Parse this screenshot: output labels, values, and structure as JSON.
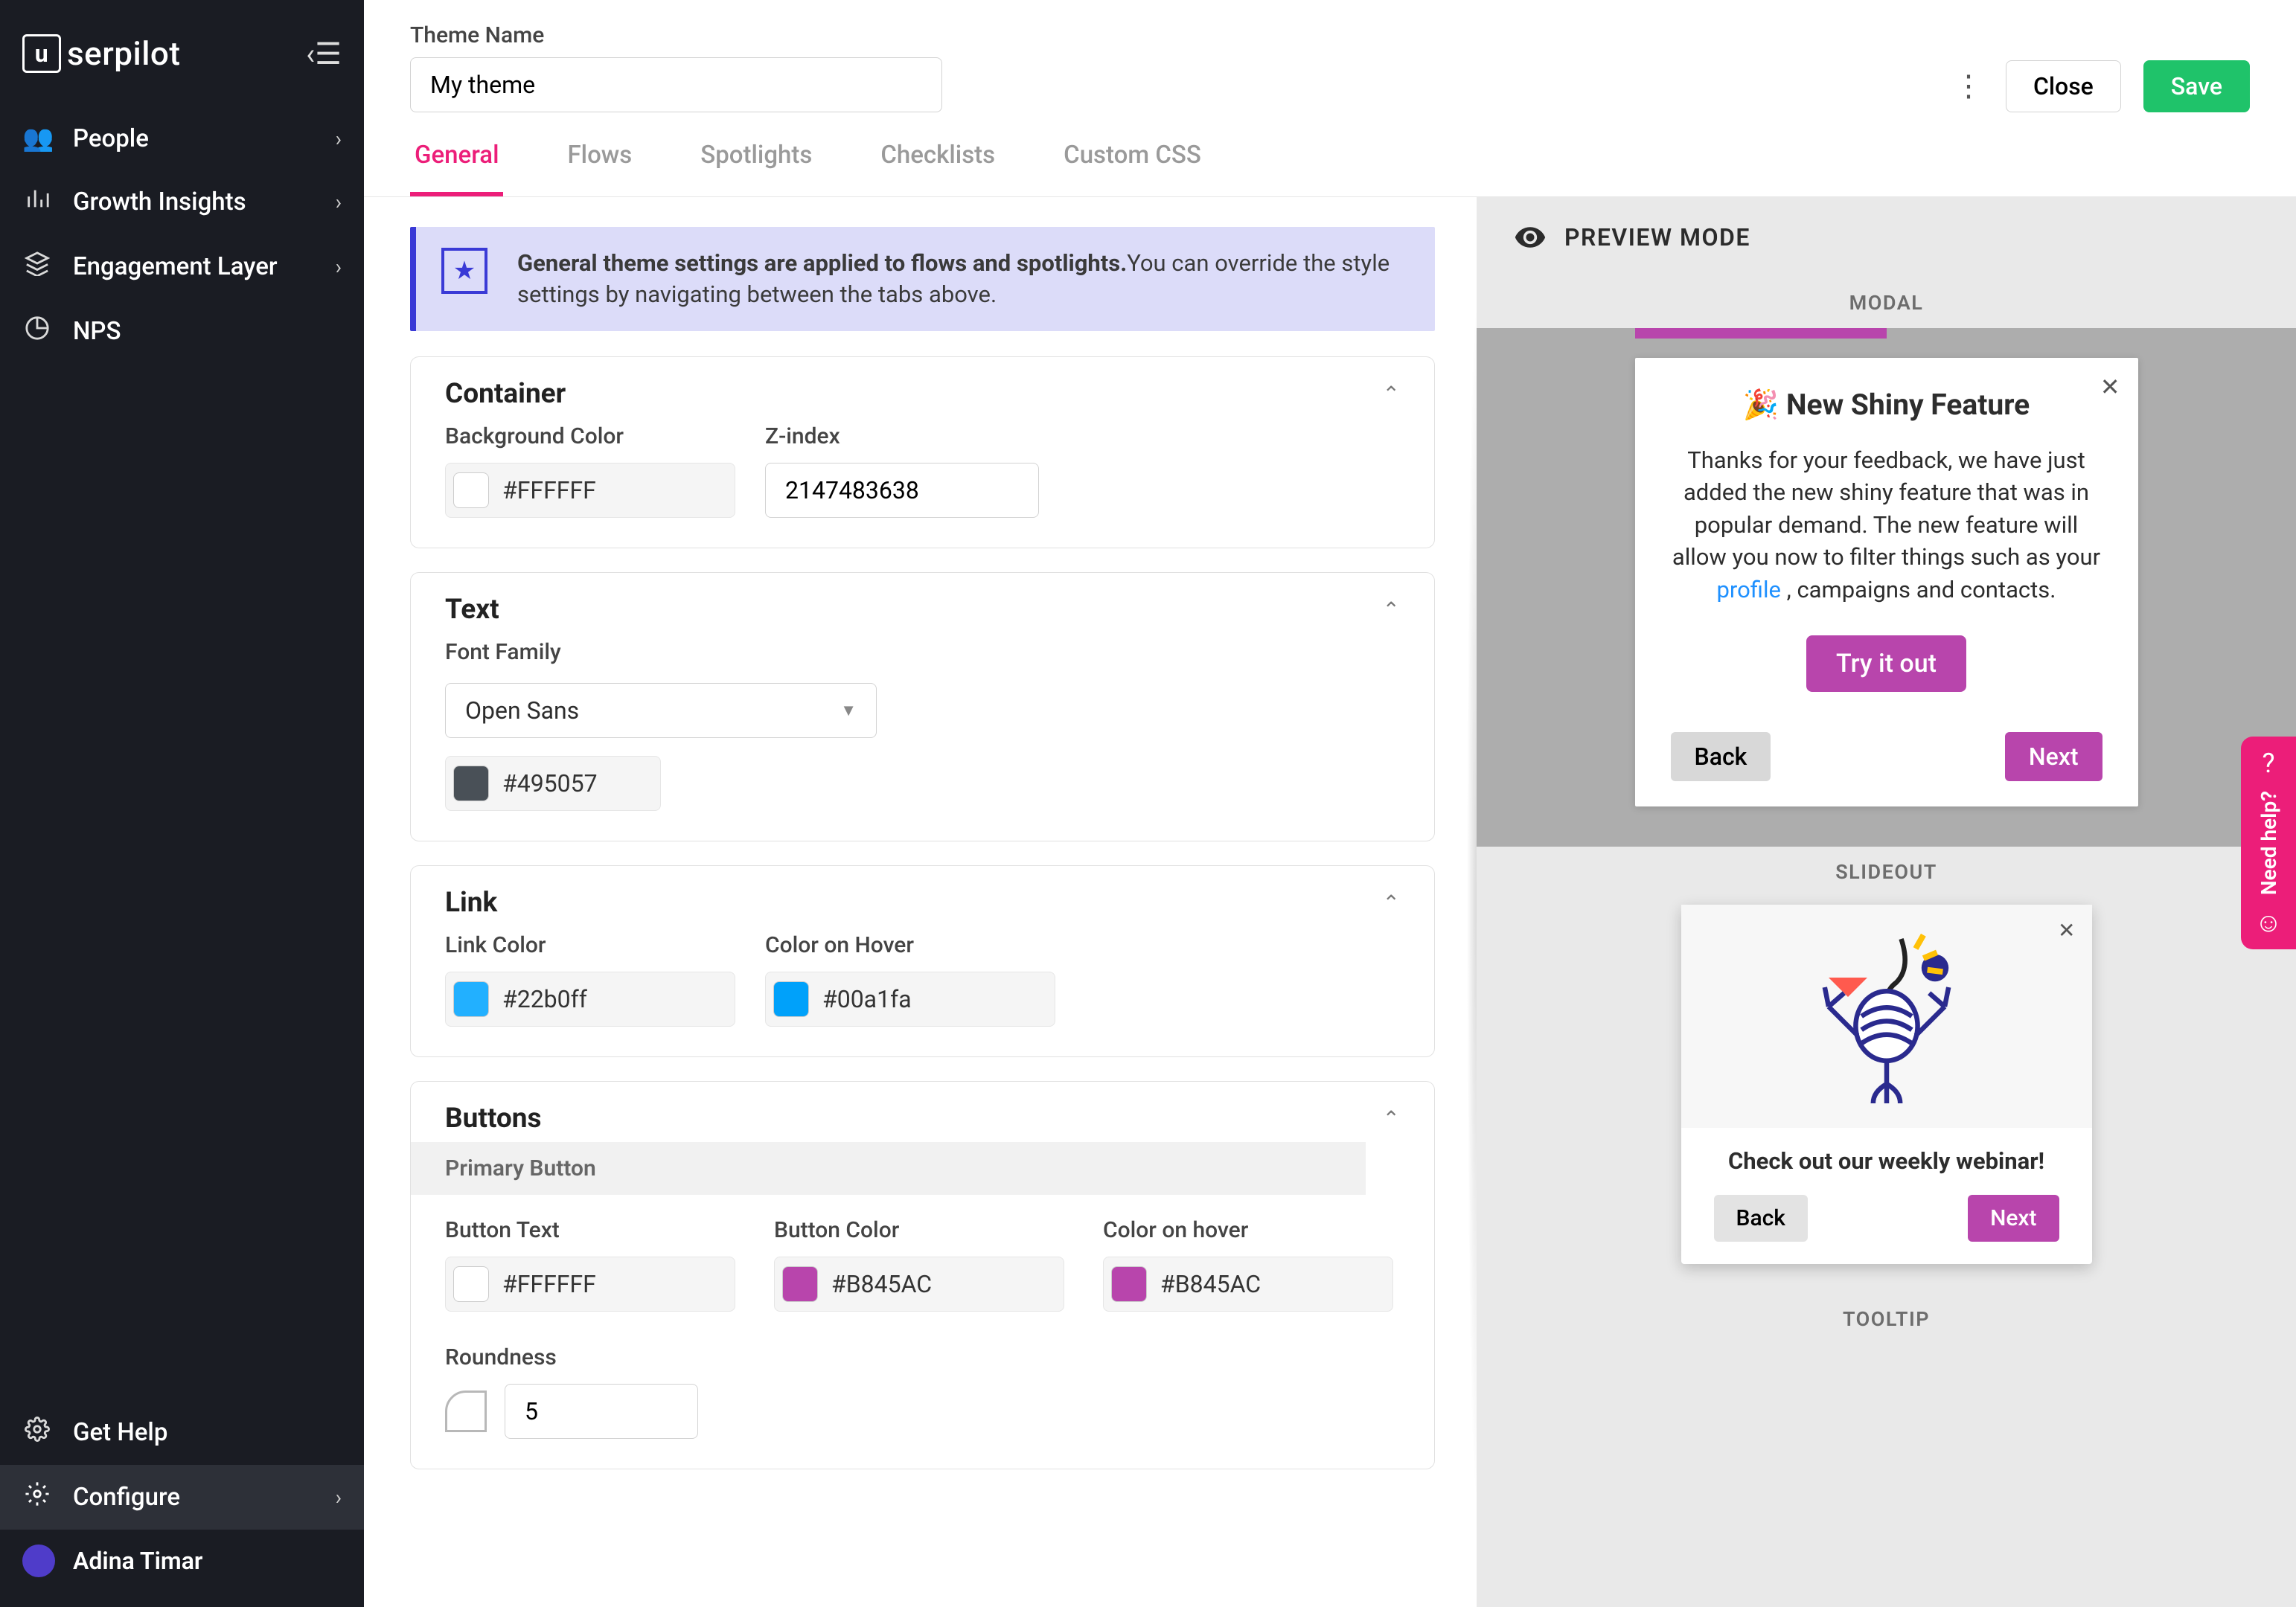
{
  "brand": "serpilot",
  "sidebar": {
    "items": [
      {
        "label": "People"
      },
      {
        "label": "Growth Insights"
      },
      {
        "label": "Engagement Layer"
      },
      {
        "label": "NPS"
      }
    ],
    "bottom": [
      {
        "label": "Get Help"
      },
      {
        "label": "Configure"
      }
    ],
    "user_name": "Adina Timar"
  },
  "header": {
    "theme_name_label": "Theme Name",
    "theme_name_value": "My theme",
    "close": "Close",
    "save": "Save"
  },
  "tabs": [
    "General",
    "Flows",
    "Spotlights",
    "Checklists",
    "Custom CSS"
  ],
  "banner": {
    "bold": "General theme settings are applied to flows and spotlights.",
    "rest": "You can override the style settings by navigating between the tabs above."
  },
  "panels": {
    "container": {
      "title": "Container",
      "bg_label": "Background Color",
      "bg_value": "#FFFFFF",
      "z_label": "Z-index",
      "z_value": "2147483638"
    },
    "text": {
      "title": "Text",
      "font_label": "Font Family",
      "font_value": "Open Sans",
      "text_color": "#495057"
    },
    "link": {
      "title": "Link",
      "link_color_label": "Link Color",
      "link_color": "#22b0ff",
      "hover_label": "Color on Hover",
      "hover_color": "#00a1fa"
    },
    "buttons": {
      "title": "Buttons",
      "primary_subhead": "Primary Button",
      "btn_text_label": "Button Text",
      "btn_text": "#FFFFFF",
      "btn_color_label": "Button Color",
      "btn_color": "#B845AC",
      "hover_label": "Color on hover",
      "hover_color": "#B845AC",
      "roundness_label": "Roundness",
      "roundness_value": "5"
    }
  },
  "preview": {
    "title": "PREVIEW MODE",
    "modal_label": "MODAL",
    "slideout_label": "SLIDEOUT",
    "tooltip_label": "TOOLTIP",
    "modal": {
      "heading": "🎉 New Shiny Feature",
      "body_a": "Thanks for your feedback, we have just added the new shiny feature that was in popular demand. The new feature will allow you now to filter things such as your ",
      "body_link": "profile",
      "body_b": " , campaigns and contacts.",
      "try": "Try it out",
      "back": "Back",
      "next": "Next"
    },
    "slideout": {
      "text": "Check out our weekly webinar!",
      "back": "Back",
      "next": "Next"
    }
  },
  "help_tab": "Need help?"
}
